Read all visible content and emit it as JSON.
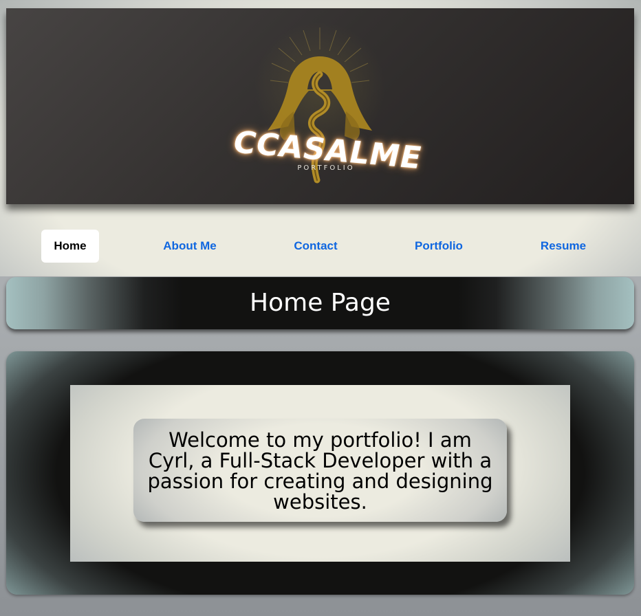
{
  "banner": {
    "logo_text": "CCASALME",
    "logo_subtitle": "PORTFOLIO",
    "logo_icon": "golden-hooded-snake-icon"
  },
  "nav": {
    "items": [
      {
        "label": "Home",
        "active": true
      },
      {
        "label": "About Me",
        "active": false
      },
      {
        "label": "Contact",
        "active": false
      },
      {
        "label": "Portfolio",
        "active": false
      },
      {
        "label": "Resume",
        "active": false
      }
    ]
  },
  "page": {
    "title": "Home Page",
    "welcome_text": "Welcome to my portfolio! I am Cyrl, a Full-Stack Developer with a passion for creating and designing websites."
  },
  "colors": {
    "nav_link": "#0f66e0",
    "banner_dark": "#2f2c2b",
    "cream": "#ecebe0",
    "teal_edge": "#a4c0c0",
    "gold": "#a88420"
  }
}
